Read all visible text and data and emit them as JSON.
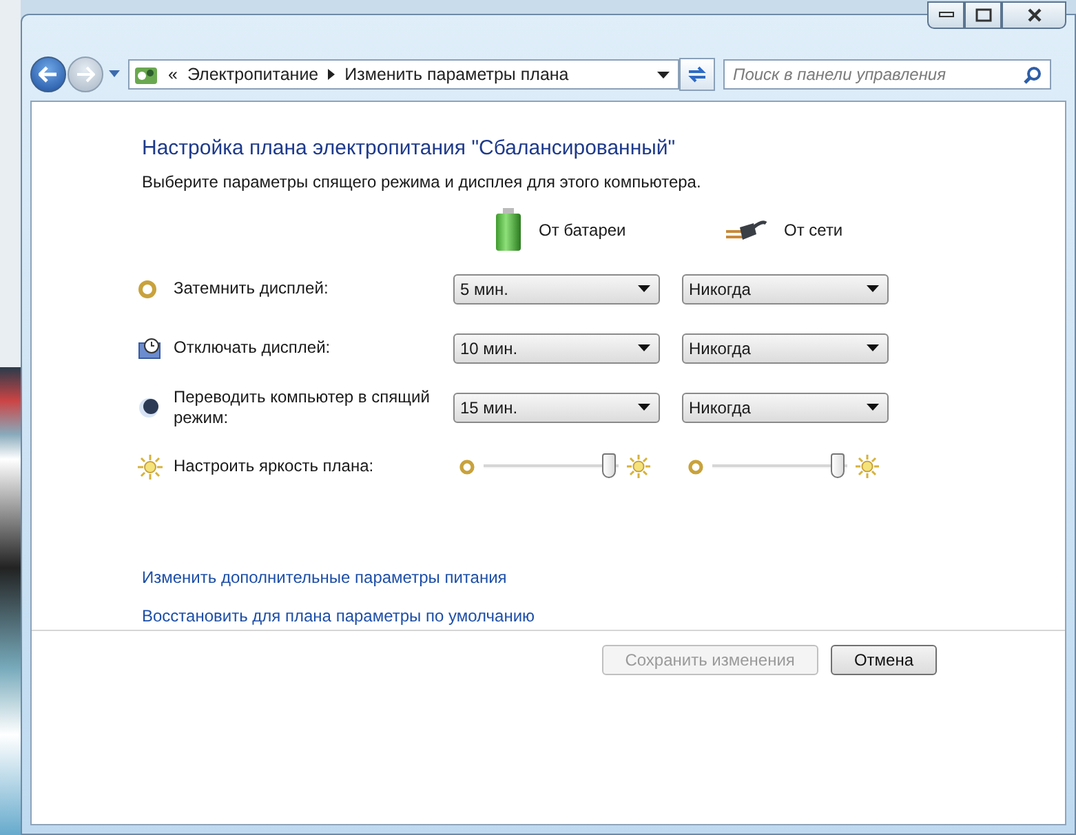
{
  "nav": {
    "prefix": "«",
    "breadcrumb": [
      "Электропитание",
      "Изменить параметры плана"
    ],
    "search": {
      "placeholder": "Поиск в панели управления"
    }
  },
  "heading": "Настройка плана электропитания \"Сбалансированный\"",
  "subtitle": "Выберите параметры спящего режима и дисплея для этого компьютера.",
  "columns": [
    {
      "kind": "battery",
      "label": "От батареи"
    },
    {
      "kind": "plug",
      "label": "От сети"
    }
  ],
  "settings": [
    {
      "kind": "dropdown",
      "label": "Затемнить дисплей:",
      "values": [
        "5 мин.",
        "Никогда"
      ]
    },
    {
      "kind": "dropdown",
      "label": "Отключать дисплей:",
      "values": [
        "10 мин.",
        "Никогда"
      ]
    },
    {
      "kind": "dropdown",
      "label": "Переводить компьютер в спящий режим:",
      "values": [
        "15 мин.",
        "Никогда"
      ]
    },
    {
      "kind": "slider",
      "label": "Настроить яркость плана:",
      "sliders": [
        {
          "level": 0.93
        },
        {
          "level": 0.93
        }
      ]
    }
  ],
  "links": [
    "Изменить дополнительные параметры питания",
    "Восстановить для плана параметры по умолчанию"
  ],
  "buttons": [
    {
      "label": "Сохранить изменения",
      "disabled": true
    },
    {
      "label": "Отмена",
      "disabled": false
    }
  ]
}
